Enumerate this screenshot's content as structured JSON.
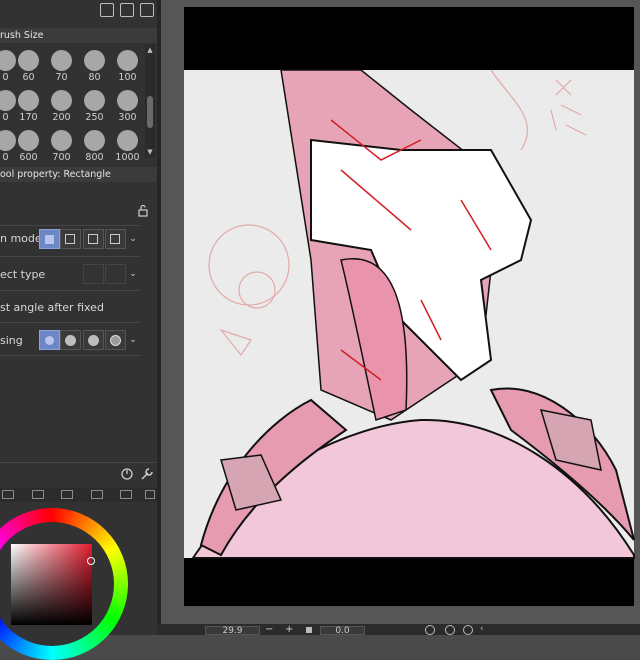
{
  "brush_size_panel": {
    "title": "rush Size",
    "rows": [
      [
        "0",
        "60",
        "70",
        "80",
        "100"
      ],
      [
        "0",
        "170",
        "200",
        "250",
        "300"
      ],
      [
        "0",
        "600",
        "700",
        "800",
        "1000"
      ]
    ]
  },
  "tool_property": {
    "title": "ool property: Rectangle",
    "rows": {
      "combination_mode": "n mode",
      "aspect_type": "ect type",
      "adjust_angle": "st angle after fixed",
      "antialiasing": "sing"
    }
  },
  "status_bar": {
    "zoom_value": "29.9",
    "minus": "−",
    "plus": "+",
    "angle_value": "0.0"
  },
  "colors": {
    "accent": "#6c86c6",
    "current_color": "#e21a2e"
  },
  "icons": [
    "export-icon",
    "duplicate-icon",
    "trash-icon",
    "lock-icon",
    "settings-icon",
    "wrench-icon"
  ]
}
